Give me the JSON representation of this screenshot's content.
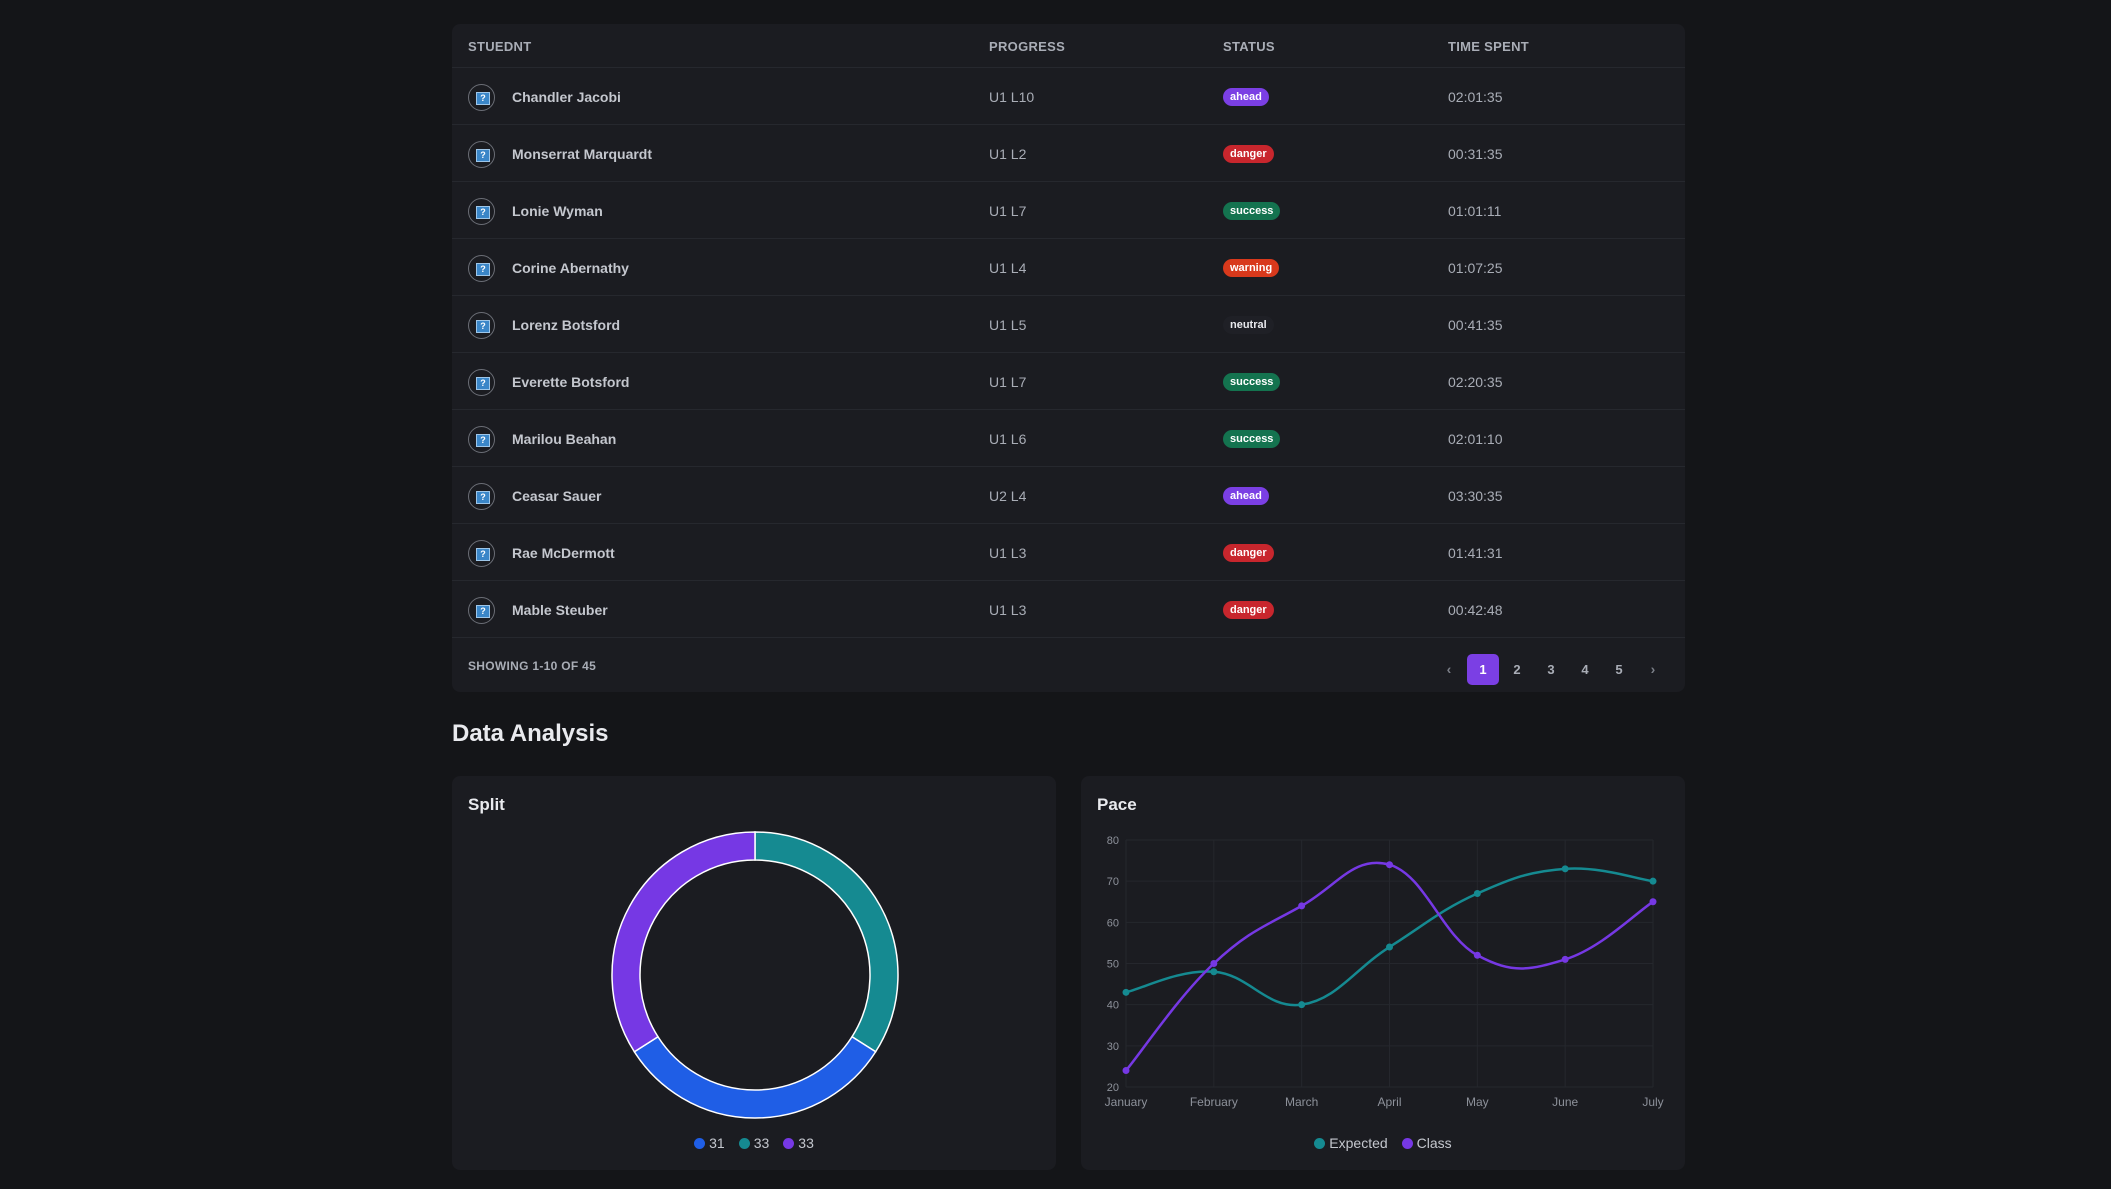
{
  "table": {
    "headers": {
      "student": "STUEDNT",
      "progress": "PROGRESS",
      "status": "STATUS",
      "time": "TIME SPENT"
    },
    "rows": [
      {
        "name": "Chandler Jacobi",
        "progress": "U1 L10",
        "status": "ahead",
        "time": "02:01:35"
      },
      {
        "name": "Monserrat Marquardt",
        "progress": "U1 L2",
        "status": "danger",
        "time": "00:31:35"
      },
      {
        "name": "Lonie Wyman",
        "progress": "U1 L7",
        "status": "success",
        "time": "01:01:11"
      },
      {
        "name": "Corine Abernathy",
        "progress": "U1 L4",
        "status": "warning",
        "time": "01:07:25"
      },
      {
        "name": "Lorenz Botsford",
        "progress": "U1 L5",
        "status": "neutral",
        "time": "00:41:35"
      },
      {
        "name": "Everette Botsford",
        "progress": "U1 L7",
        "status": "success",
        "time": "02:20:35"
      },
      {
        "name": "Marilou Beahan",
        "progress": "U1 L6",
        "status": "success",
        "time": "02:01:10"
      },
      {
        "name": "Ceasar Sauer",
        "progress": "U2 L4",
        "status": "ahead",
        "time": "03:30:35"
      },
      {
        "name": "Rae McDermott",
        "progress": "U1 L3",
        "status": "danger",
        "time": "01:41:31"
      },
      {
        "name": "Mable Steuber",
        "progress": "U1 L3",
        "status": "danger",
        "time": "00:42:48"
      }
    ],
    "avatar_glyph": "?",
    "showing": "SHOWING 1-10 OF 45",
    "pagination": {
      "prev": "‹",
      "next": "›",
      "pages": [
        "1",
        "2",
        "3",
        "4",
        "5"
      ],
      "current": "1"
    }
  },
  "status_colors": {
    "ahead": "#7b3fe4",
    "danger": "#c8262d",
    "success": "#14734f",
    "warning": "#d8391c",
    "neutral": "#1f2026"
  },
  "section": {
    "title": "Data Analysis"
  },
  "split": {
    "title": "Split"
  },
  "pace": {
    "title": "Pace"
  },
  "chart_data": [
    {
      "type": "pie",
      "title": "Split",
      "donut": true,
      "slices": [
        {
          "label": "31",
          "value": 31,
          "color": "#1f5ee6"
        },
        {
          "label": "33",
          "value": 33,
          "color": "#158a91"
        },
        {
          "label": "33",
          "value": 33,
          "color": "#7638e4"
        }
      ],
      "legend": "bottom"
    },
    {
      "type": "line",
      "title": "Pace",
      "x": [
        "January",
        "February",
        "March",
        "April",
        "May",
        "June",
        "July"
      ],
      "series": [
        {
          "name": "Expected",
          "color": "#158a91",
          "values": [
            43,
            48,
            40,
            54,
            67,
            73,
            70
          ]
        },
        {
          "name": "Class",
          "color": "#7638e4",
          "values": [
            24,
            50,
            64,
            74,
            52,
            51,
            65
          ]
        }
      ],
      "yticks": [
        20,
        30,
        40,
        50,
        60,
        70,
        80
      ],
      "ylim": [
        20,
        80
      ],
      "grid": true,
      "legend": "bottom"
    }
  ]
}
